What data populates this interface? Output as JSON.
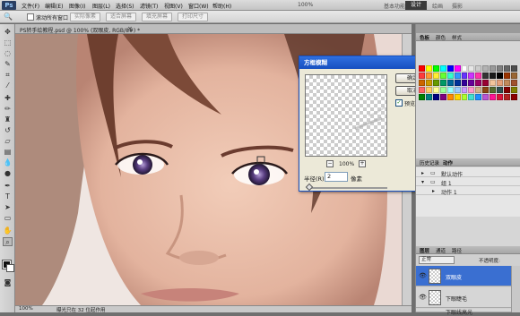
{
  "app": {
    "logo": "Ps"
  },
  "menu": {
    "items": [
      "文件(F)",
      "编辑(E)",
      "图像(I)",
      "图层(L)",
      "选择(S)",
      "滤镜(T)",
      "视图(V)",
      "窗口(W)",
      "帮助(H)"
    ],
    "zoom": "100%",
    "workspace_active": "设计",
    "workspace_items": [
      "基本功能",
      "绘画",
      "摄影"
    ]
  },
  "options_bar": {
    "scroll_all_label": "滚动所有窗口",
    "buttons": [
      "实际像素",
      "适合屏幕",
      "填充屏幕",
      "打印尺寸"
    ]
  },
  "document": {
    "tab_title": "PS转手绘教程.psd @ 100% (双眼皮, RGB/8#) *",
    "zoom_status": "100%",
    "info_status": "曝光只在 32 位起作用"
  },
  "dialog": {
    "title": "方框模糊",
    "ok_label": "确定",
    "cancel_label": "取消",
    "preview_label": "预览(P)",
    "preview_checked": true,
    "zoom_level": "100%",
    "radius_label": "半径(R):",
    "radius_value": "2",
    "radius_unit": "像素",
    "zoom_minus": "−",
    "zoom_plus": "+"
  },
  "swatches_panel": {
    "tabs": [
      "色板",
      "颜色",
      "样式"
    ]
  },
  "actions_panel": {
    "tabs": [
      "历史记录",
      "动作"
    ],
    "items": [
      "默认动作",
      "组 1",
      "动作 1"
    ]
  },
  "layers_panel": {
    "tabs": [
      "图层",
      "通道",
      "路径"
    ],
    "blend_mode": "正常",
    "opacity_label": "不透明度:",
    "layers": [
      "双眼皮",
      "下眼睫毛",
      "下眼线高光"
    ]
  },
  "colors": {
    "swatch_palette": [
      "#ff0000",
      "#ffff00",
      "#00ff00",
      "#00ffff",
      "#0000ff",
      "#ff00ff",
      "#ffffff",
      "#e6e6e6",
      "#cccccc",
      "#b3b3b3",
      "#999999",
      "#808080",
      "#666666",
      "#4d4d4d",
      "#ff3b3b",
      "#ff9933",
      "#ffee33",
      "#66ff33",
      "#33ffcc",
      "#3399ff",
      "#6633ff",
      "#cc33ff",
      "#ff33aa",
      "#333333",
      "#1a1a1a",
      "#000000",
      "#993300",
      "#996633",
      "#cc6600",
      "#cc9900",
      "#669900",
      "#009966",
      "#006699",
      "#003399",
      "#330099",
      "#660099",
      "#990066",
      "#990033",
      "#f2c49b",
      "#e5a07a",
      "#c28a5b",
      "#a0522d",
      "#ff6666",
      "#ffcc66",
      "#ffff99",
      "#99ff99",
      "#99ffff",
      "#99ccff",
      "#cc99ff",
      "#ff99cc",
      "#d2b48c",
      "#8b4513",
      "#556b2f",
      "#2f4f4f",
      "#800000",
      "#808000",
      "#008000",
      "#008080",
      "#000080",
      "#800080",
      "#ff8c00",
      "#ffd700",
      "#adff2f",
      "#40e0d0",
      "#1e90ff",
      "#ba55d3",
      "#ff1493",
      "#dc143c",
      "#b22222",
      "#8b0000"
    ],
    "accent": "#164fc0",
    "active_layer": "#3a6fd1"
  }
}
